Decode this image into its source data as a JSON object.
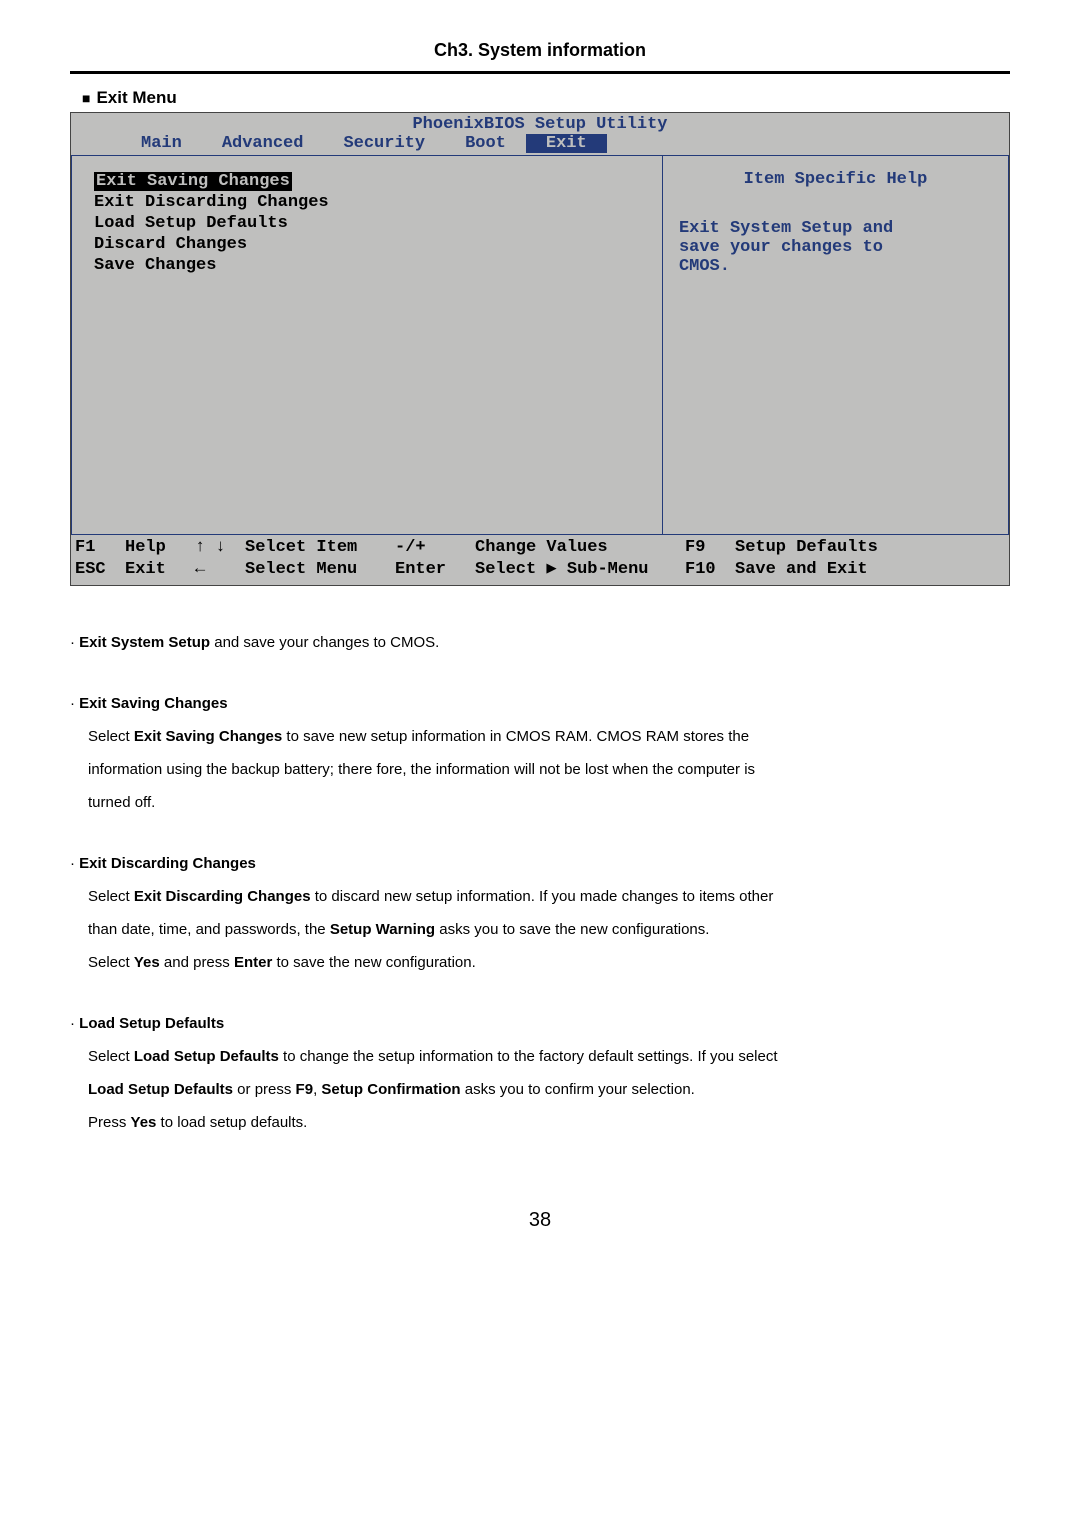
{
  "chapter": "Ch3. System information",
  "sectionTitle": "Exit Menu",
  "bios": {
    "title": "PhoenixBIOS Setup Utility",
    "tabs": {
      "main": "Main",
      "advanced": "Advanced",
      "security": "Security",
      "boot": "Boot",
      "exit": "Exit"
    },
    "menu": {
      "saving": "Exit Saving Changes",
      "discarding": "Exit Discarding Changes",
      "loadDefaults": "Load Setup Defaults",
      "discard": "Discard Changes",
      "save": "Save Changes"
    },
    "help": {
      "title": "Item Specific Help",
      "text1": "Exit System Setup and",
      "text2": "save your changes to",
      "text3": "CMOS."
    },
    "footer": {
      "f1": "F1",
      "help": "Help",
      "arrows_ud": "↑ ↓",
      "selcet": "Selcet Item",
      "minplus": "-/+",
      "change": "Change Values",
      "f9": "F9",
      "setupdef": "Setup Defaults",
      "esc": "ESC",
      "exit": "Exit",
      "arrow_l": "←",
      "selmenu": "Select Menu",
      "enter": "Enter",
      "select": "Select",
      "tri": "▶",
      "submenu": "Sub-Menu",
      "f10": "F10",
      "saveexit": "Save and Exit"
    }
  },
  "content": {
    "p1_b": "Exit System Setup",
    "p1_r": " and save your changes to CMOS.",
    "h2": "Exit Saving Changes",
    "p2a": "Select ",
    "p2b": "Exit Saving Changes",
    "p2c": " to save new setup information in CMOS RAM. CMOS RAM stores the",
    "p2d": "information using the backup battery; there fore, the information will not be lost when the computer is",
    "p2e": "turned off.",
    "h3": "Exit Discarding Changes",
    "p3a": "Select ",
    "p3b": "Exit Discarding Changes",
    "p3c": " to discard new setup information. If you made changes to items other",
    "p3d": "than date, time, and passwords, the ",
    "p3e": "Setup Warning",
    "p3f": " asks you to save the new configurations.",
    "p3g": "Select ",
    "p3h": "Yes",
    "p3i": " and press ",
    "p3j": "Enter",
    "p3k": " to save the new configuration.",
    "h4": "Load Setup Defaults",
    "p4a": "Select ",
    "p4b": "Load Setup Defaults",
    "p4c": " to change the setup information to the factory default settings. If you select",
    "p4d": "Load Setup Defaults",
    "p4e": " or press ",
    "p4f": "F9",
    "p4g": ", ",
    "p4h": "Setup Confirmation",
    "p4i": " asks you to confirm your selection.",
    "p4j": "Press ",
    "p4k": "Yes",
    "p4l": " to load setup defaults."
  },
  "pageNumber": "38",
  "dot": "·"
}
